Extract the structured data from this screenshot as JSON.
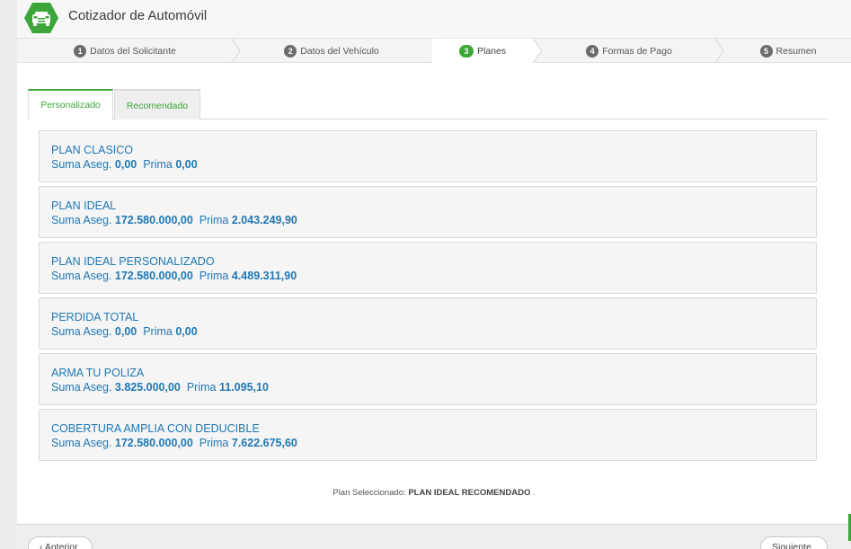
{
  "app": {
    "title": "Cotizador de Automóvil",
    "accent_color": "#3ca63a",
    "link_color": "#1f78b4",
    "logo_icon": "car-icon"
  },
  "steps": [
    {
      "num": "1",
      "label": "Datos del Solicitante",
      "active": false
    },
    {
      "num": "2",
      "label": "Datos del Vehículo",
      "active": false
    },
    {
      "num": "3",
      "label": "Planes",
      "active": true
    },
    {
      "num": "4",
      "label": "Formas de Pago",
      "active": false
    },
    {
      "num": "5",
      "label": "Resumen",
      "active": false
    }
  ],
  "tabs": [
    {
      "label": "Personalizado",
      "active": true
    },
    {
      "label": "Recomendado",
      "active": false
    }
  ],
  "plan_labels": {
    "suma": "Suma Aseg.",
    "prima": "Prima"
  },
  "plans": [
    {
      "name": "PLAN CLASICO",
      "suma": "0,00",
      "prima": "0,00"
    },
    {
      "name": "PLAN IDEAL",
      "suma": "172.580.000,00",
      "prima": "2.043.249,90"
    },
    {
      "name": "PLAN IDEAL PERSONALIZADO",
      "suma": "172.580.000,00",
      "prima": "4.489.311,90"
    },
    {
      "name": "PERDIDA TOTAL",
      "suma": "0,00",
      "prima": "0,00"
    },
    {
      "name": "ARMA TU POLIZA",
      "suma": "3.825.000,00",
      "prima": "11.095,10"
    },
    {
      "name": "COBERTURA AMPLIA CON DEDUCIBLE",
      "suma": "172.580.000,00",
      "prima": "7.622.675,60"
    }
  ],
  "selected": {
    "label": "Plan Seleccionado:",
    "value": "PLAN IDEAL RECOMENDADO",
    "suffix": "."
  },
  "footer": {
    "prev_label": "‹ Anterior",
    "next_label": "Siguiente ›"
  }
}
